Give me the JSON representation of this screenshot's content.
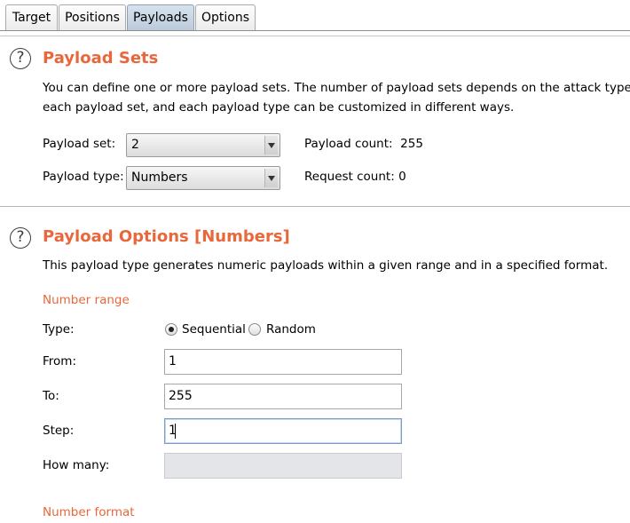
{
  "tabs": [
    {
      "label": "Target"
    },
    {
      "label": "Positions"
    },
    {
      "label": "Payloads",
      "active": true
    },
    {
      "label": "Options"
    }
  ],
  "payload_sets": {
    "help_icon": "question-circle-icon",
    "title": "Payload Sets",
    "description_line1": "You can define one or more payload sets. The number of payload sets depends on the attack type defi",
    "description_line2": "each payload set, and each payload type can be customized in different ways.",
    "payload_set_label": "Payload set:",
    "payload_set_value": "2",
    "payload_type_label": "Payload type:",
    "payload_type_value": "Numbers",
    "payload_count_label": "Payload count:",
    "payload_count_value": "255",
    "request_count_label": "Request count:",
    "request_count_value": "0"
  },
  "payload_options": {
    "help_icon": "question-circle-icon",
    "title": "Payload Options [Numbers]",
    "description": "This payload type generates numeric payloads within a given range and in a specified format.",
    "number_range_heading": "Number range",
    "type_label": "Type:",
    "type_options": [
      {
        "label": "Sequential",
        "checked": true
      },
      {
        "label": "Random",
        "checked": false
      }
    ],
    "from_label": "From:",
    "from_value": "1",
    "to_label": "To:",
    "to_value": "255",
    "step_label": "Step:",
    "step_value": "1",
    "how_many_label": "How many:",
    "how_many_value": "",
    "number_format_heading": "Number format"
  },
  "colors": {
    "accent_orange": "#e8683b",
    "active_tab": "#c8d6e5"
  }
}
